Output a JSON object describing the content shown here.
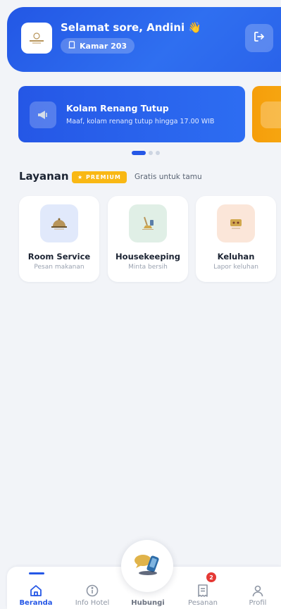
{
  "header": {
    "greeting": "Selamat sore, Andini 👋",
    "room_label": "Kamar 203",
    "logo_icon": "hotel-logo-icon",
    "logout_icon": "logout-icon"
  },
  "banners": [
    {
      "title": "Kolam Renang Tutup",
      "subtitle": "Maaf, kolam renang tutup hingga 17.00 WIB",
      "icon": "megaphone-icon",
      "color": "#2557e6"
    },
    {
      "title": "",
      "subtitle": "",
      "icon": "megaphone-icon",
      "color": "#f59e0b"
    }
  ],
  "carousel": {
    "active_index": 0,
    "count": 3
  },
  "services": {
    "title": "Layanan",
    "badge": "★ PREMIUM",
    "subtitle": "Gratis untuk tamu",
    "items": [
      {
        "title": "Room Service",
        "subtitle": "Pesan makanan",
        "icon": "room-service-icon",
        "bg": "#e1e9fb"
      },
      {
        "title": "Housekeeping",
        "subtitle": "Minta bersih",
        "icon": "housekeeping-icon",
        "bg": "#e0efe6"
      },
      {
        "title": "Keluhan",
        "subtitle": "Lapor keluhan",
        "icon": "complaint-icon",
        "bg": "#fbe6d9"
      }
    ]
  },
  "nav": {
    "items": [
      {
        "label": "Beranda",
        "icon": "home-icon",
        "active": true
      },
      {
        "label": "Info Hotel",
        "icon": "info-icon",
        "active": false
      },
      {
        "label": "Hubungi",
        "icon": "contact-icon",
        "active": false
      },
      {
        "label": "Pesanan",
        "icon": "orders-icon",
        "active": false,
        "badge": "2"
      },
      {
        "label": "Profil",
        "icon": "profile-icon",
        "active": false
      }
    ]
  },
  "colors": {
    "primary": "#2557e6",
    "premium": "#f9b814",
    "accent_orange": "#f59e0b",
    "badge_red": "#e53935"
  }
}
